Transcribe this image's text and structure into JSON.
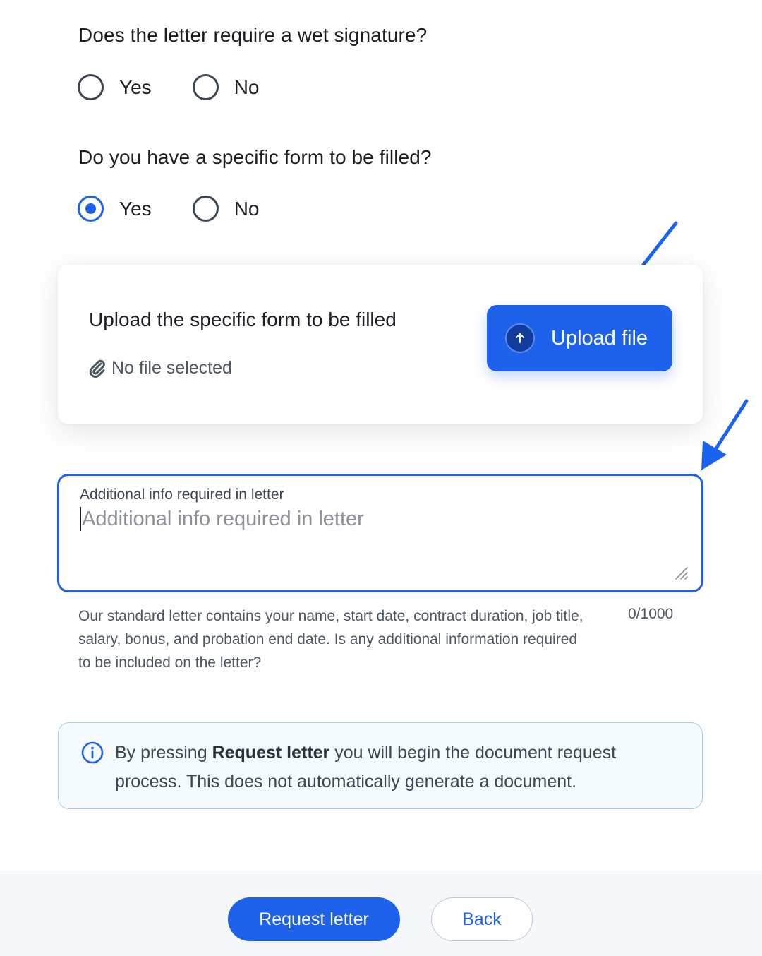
{
  "wet_signature": {
    "question": "Does the letter require a wet signature?",
    "options": [
      {
        "label": "Yes",
        "selected": false
      },
      {
        "label": "No",
        "selected": false
      }
    ]
  },
  "specific_form": {
    "question": "Do you have a specific form to be filled?",
    "options": [
      {
        "label": "Yes",
        "selected": true
      },
      {
        "label": "No",
        "selected": false
      }
    ]
  },
  "upload_card": {
    "title": "Upload the specific form to be filled",
    "file_status": "No file selected",
    "file_status_icon": "paperclip-icon",
    "button_label": "Upload file",
    "button_icon": "arrow-up-circle-icon"
  },
  "additional_info": {
    "label": "Additional info required in letter",
    "placeholder": "Additional info required in letter",
    "value": "",
    "helper_text": "Our standard letter contains your name, start date, contract duration, job title, salary, bonus, and probation end date. Is any additional information required to be included on the letter?",
    "counter": "0/1000"
  },
  "info_notice": {
    "icon": "info-icon",
    "text_before": "By pressing ",
    "text_bold": "Request letter",
    "text_after": " you will begin the document request process. This does not automatically generate a document."
  },
  "footer": {
    "primary_label": "Request letter",
    "secondary_label": "Back"
  },
  "colors": {
    "accent": "#1e62ec",
    "annotation_arrow": "#1a63f0",
    "text": "#1b1f24",
    "info_border": "#a9cde8"
  }
}
